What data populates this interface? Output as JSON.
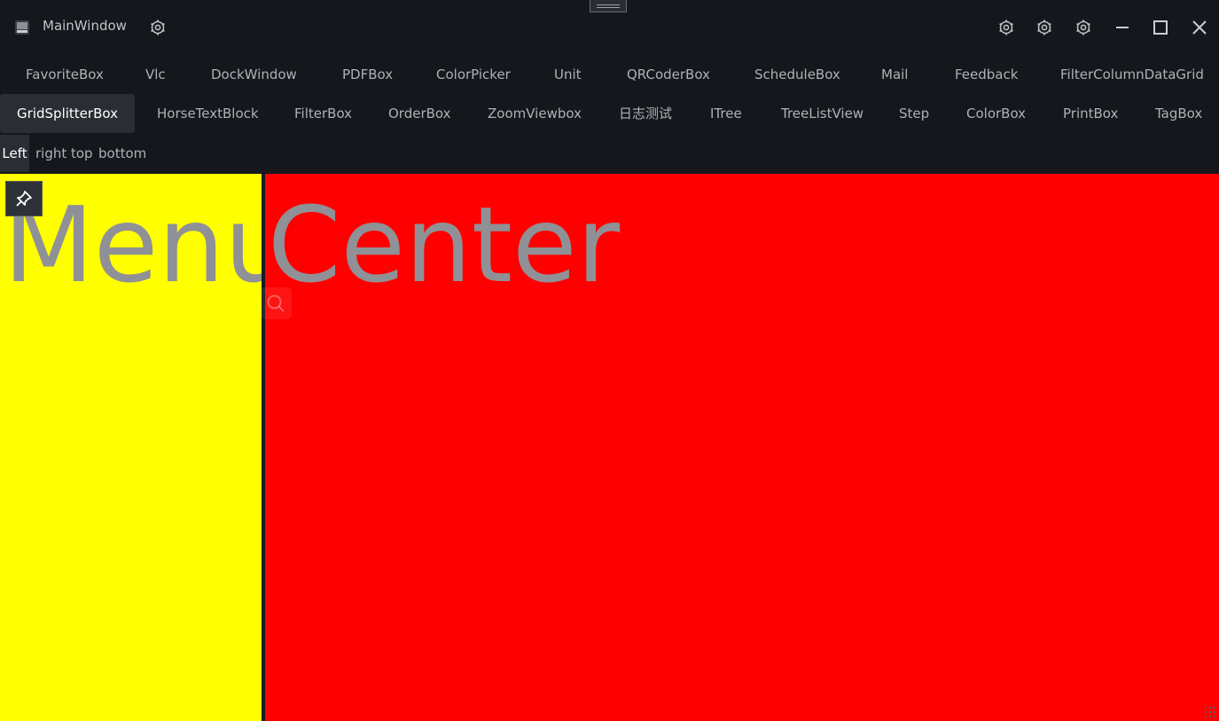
{
  "window": {
    "title": "MainWindow",
    "icons": [
      "app-icon",
      "gear-icon"
    ],
    "controls": [
      "gear-icon",
      "gear-icon",
      "gear-icon",
      "minimize-icon",
      "maximize-icon",
      "close-icon"
    ]
  },
  "tabs_row1": [
    "FavoriteBox",
    "Vlc",
    "DockWindow",
    "PDFBox",
    "ColorPicker",
    "Unit",
    "QRCoderBox",
    "ScheduleBox",
    "Mail",
    "Feedback",
    "FilterColumnDataGrid"
  ],
  "tabs_row2": [
    "GridSplitterBox",
    "HorseTextBlock",
    "FilterBox",
    "OrderBox",
    "ZoomViewbox",
    "日志测试",
    "ITree",
    "TreeListView",
    "Step",
    "ColorBox",
    "PrintBox",
    "TagBox"
  ],
  "tabs_row2_active": "GridSplitterBox",
  "subtabs": [
    "Left",
    "right",
    "top",
    "bottom"
  ],
  "subtabs_active": "Left",
  "panes": {
    "left_label": "Menu",
    "center_label": "Center",
    "left_color": "#ffff00",
    "center_color": "#ff0000"
  }
}
